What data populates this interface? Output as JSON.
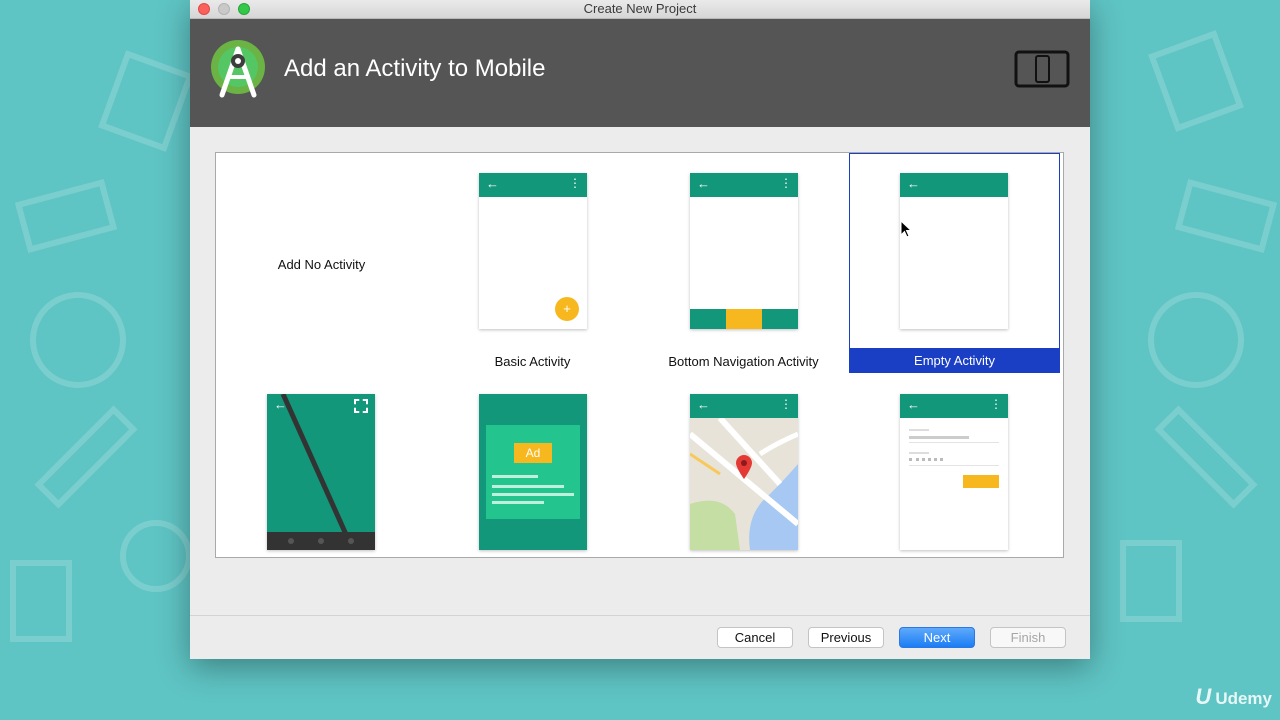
{
  "window": {
    "title": "Create New Project"
  },
  "header": {
    "title": "Add an Activity to Mobile",
    "logo_icon": "android-studio-logo-icon",
    "device_icon": "tablet-phone-icon"
  },
  "gallery": {
    "tiles": [
      {
        "label": "Add No Activity",
        "selected": false
      },
      {
        "label": "Basic Activity",
        "selected": false
      },
      {
        "label": "Bottom Navigation Activity",
        "selected": false
      },
      {
        "label": "Empty Activity",
        "selected": true
      },
      {
        "label": "",
        "selected": false
      },
      {
        "label": "",
        "selected": false
      },
      {
        "label": "",
        "selected": false
      },
      {
        "label": "",
        "selected": false
      }
    ],
    "ad_badge": "Ad",
    "fab_symbol": "+"
  },
  "footer": {
    "cancel_label": "Cancel",
    "previous_label": "Previous",
    "next_label": "Next",
    "finish_label": "Finish"
  },
  "watermark": {
    "mark": "U",
    "brand": "Udemy"
  },
  "colors": {
    "accent_green": "#12977a",
    "fab_yellow": "#f7b81f",
    "selection_blue": "#1a3fc4",
    "header_gray": "#555555",
    "background_teal": "#5fc4c4"
  }
}
